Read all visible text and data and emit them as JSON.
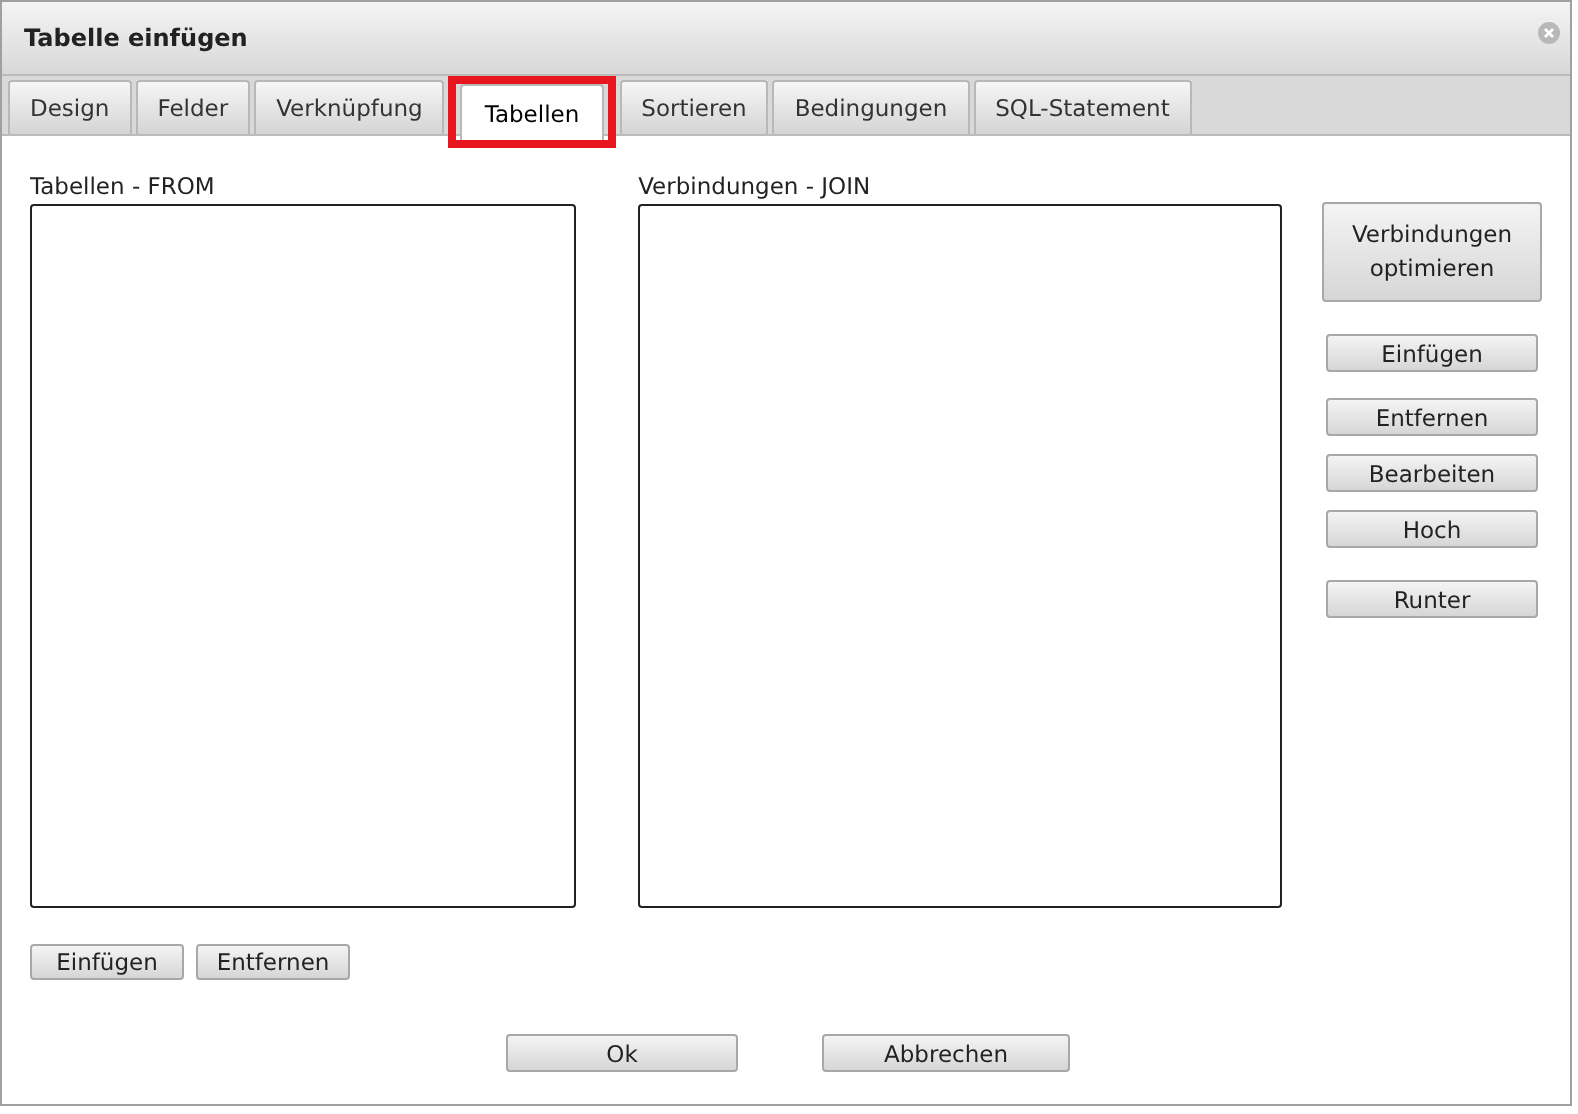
{
  "window": {
    "title": "Tabelle einfügen"
  },
  "tabs": [
    {
      "label": "Design",
      "selected": false,
      "highlighted": false
    },
    {
      "label": "Felder",
      "selected": false,
      "highlighted": false
    },
    {
      "label": "Verknüpfung",
      "selected": false,
      "highlighted": false
    },
    {
      "label": "Tabellen",
      "selected": true,
      "highlighted": true
    },
    {
      "label": "Sortieren",
      "selected": false,
      "highlighted": false
    },
    {
      "label": "Bedingungen",
      "selected": false,
      "highlighted": false
    },
    {
      "label": "SQL-Statement",
      "selected": false,
      "highlighted": false
    }
  ],
  "from_panel": {
    "label": "Tabellen - FROM",
    "buttons": [
      "Einfügen",
      "Entfernen"
    ]
  },
  "join_panel": {
    "label": "Verbindungen - JOIN"
  },
  "side_buttons": [
    "Verbindungen optimieren",
    "Einfügen",
    "Entfernen",
    "Bearbeiten",
    "Hoch",
    "Runter"
  ],
  "footer_buttons": [
    "Ok",
    "Abbrechen"
  ]
}
